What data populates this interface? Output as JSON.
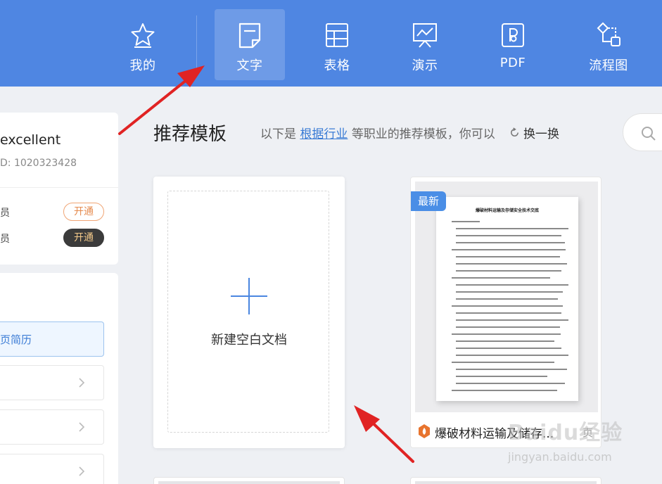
{
  "nav": {
    "items": [
      {
        "label": "我的",
        "icon": "star-icon"
      },
      {
        "label": "文字",
        "icon": "document-icon"
      },
      {
        "label": "表格",
        "icon": "spreadsheet-icon"
      },
      {
        "label": "演示",
        "icon": "presentation-icon"
      },
      {
        "label": "PDF",
        "icon": "pdf-icon"
      },
      {
        "label": "流程图",
        "icon": "flowchart-icon"
      }
    ],
    "active": "文字"
  },
  "profile": {
    "name": "excellent",
    "id": "D: 1020323428",
    "vip_rows": [
      {
        "text": "员",
        "button": "开通"
      },
      {
        "text": "员",
        "button": "开通"
      }
    ]
  },
  "sidebar": {
    "items": [
      {
        "label": "页简历"
      },
      {
        "label": ""
      },
      {
        "label": ""
      },
      {
        "label": ""
      }
    ]
  },
  "main": {
    "title": "推荐模板",
    "desc_prefix": "以下是",
    "desc_link": "根据行业",
    "desc_suffix": "等职业的推荐模板，你可以",
    "refresh_label": "换一换",
    "new_blank_label": "新建空白文档"
  },
  "template": {
    "badge": "最新",
    "doc_title": "爆破材料运输及存储安全技术交底",
    "name": "爆破材料运输及储存...",
    "pages": "页"
  },
  "watermark": {
    "logo": "Baidu经验",
    "url": "jingyan.baidu.com"
  },
  "colors": {
    "nav_bg": "#4f86e2",
    "accent": "#3a7bd5",
    "arrow": "#e02323",
    "badge_new": "#4a8ee6"
  }
}
